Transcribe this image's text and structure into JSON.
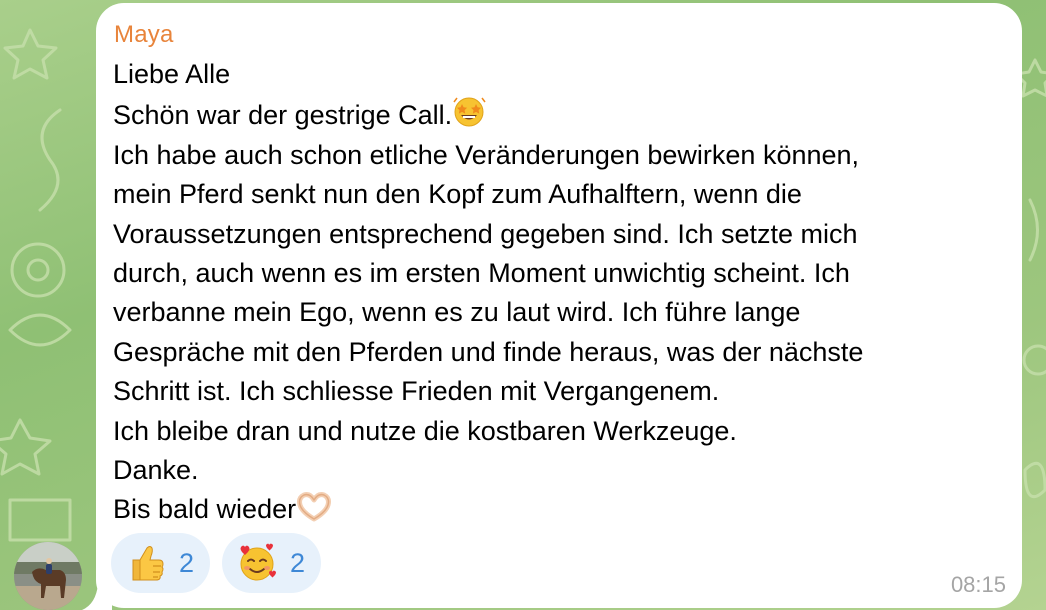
{
  "message": {
    "sender": "Maya",
    "lines": [
      "Liebe Alle",
      "Schön war der gestrige Call.",
      "Ich habe auch schon etliche Veränderungen bewirken können,",
      "mein Pferd senkt nun den Kopf zum Aufhalftern, wenn die",
      "Voraussetzungen entsprechend gegeben sind. Ich setzte mich",
      "durch, auch wenn es im ersten Moment unwichtig scheint. Ich",
      "verbanne mein Ego, wenn es zu laut wird. Ich führe lange",
      "Gespräche mit den Pferden und finde heraus, was der nächste",
      "Schritt ist. Ich schliesse Frieden mit Vergangenem.",
      "Ich bleibe dran und nutze die kostbaren Werkzeuge.",
      "Danke.",
      "Bis bald wieder"
    ],
    "inline_emojis": {
      "line_2": "star-struck-icon",
      "line_12": "heart-hands-icon"
    },
    "time": "08:15"
  },
  "reactions": [
    {
      "icon": "thumbs-up-icon",
      "count": "2"
    },
    {
      "icon": "smiling-face-with-hearts-icon",
      "count": "2"
    }
  ],
  "colors": {
    "sender_name": "#e8843b",
    "reaction_bg": "#e7f1fb",
    "reaction_count": "#3e88d6",
    "timestamp": "#a5a5a5",
    "wallpaper": "#9dc67e"
  }
}
